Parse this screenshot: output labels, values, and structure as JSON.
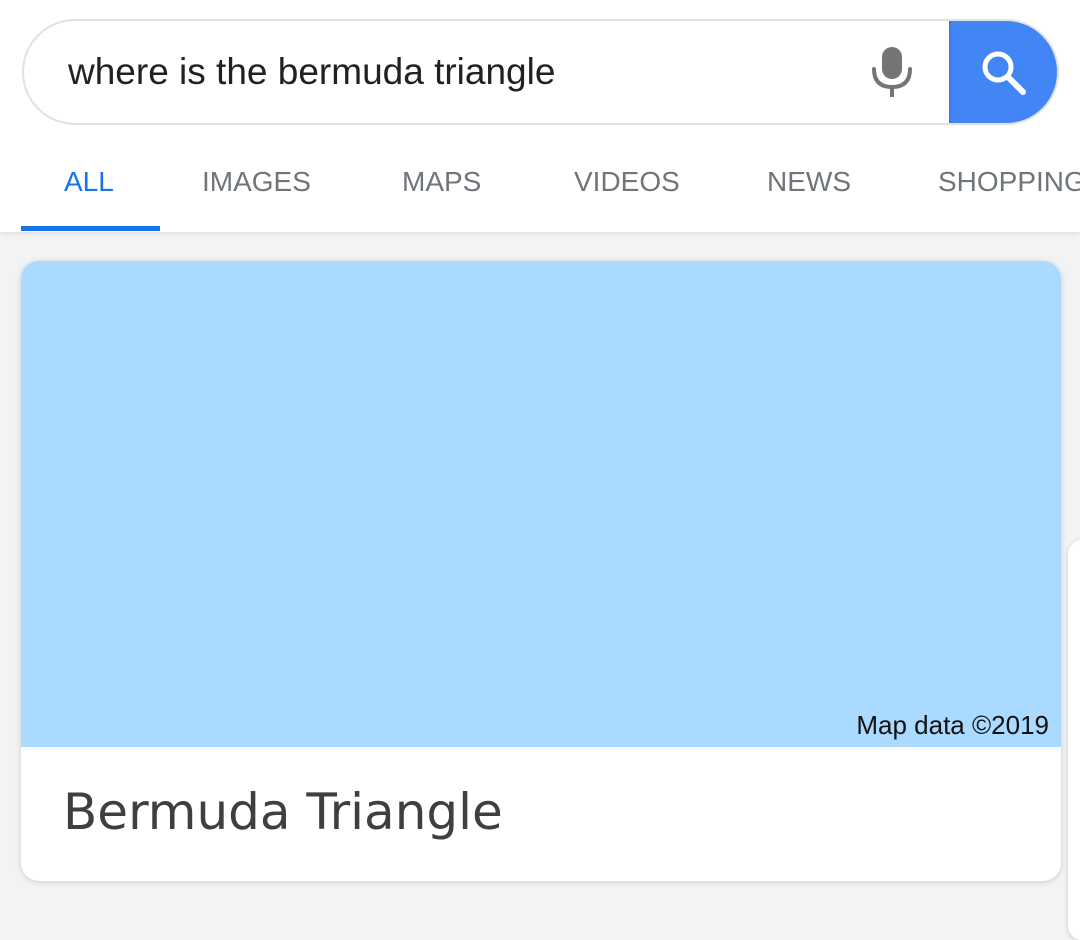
{
  "search": {
    "query": "where is the bermuda triangle"
  },
  "tabs": [
    {
      "label": "ALL",
      "active": true
    },
    {
      "label": "IMAGES",
      "active": false
    },
    {
      "label": "MAPS",
      "active": false
    },
    {
      "label": "VIDEOS",
      "active": false
    },
    {
      "label": "NEWS",
      "active": false
    },
    {
      "label": "SHOPPING",
      "active": false
    }
  ],
  "result_card": {
    "map_credit": "Map data ©2019",
    "title": "Bermuda Triangle"
  },
  "icons": {
    "mic": "microphone-icon",
    "search": "search-icon"
  },
  "colors": {
    "accent": "#1a73e8",
    "search_button": "#4285f4",
    "map_water": "#aadaff"
  }
}
